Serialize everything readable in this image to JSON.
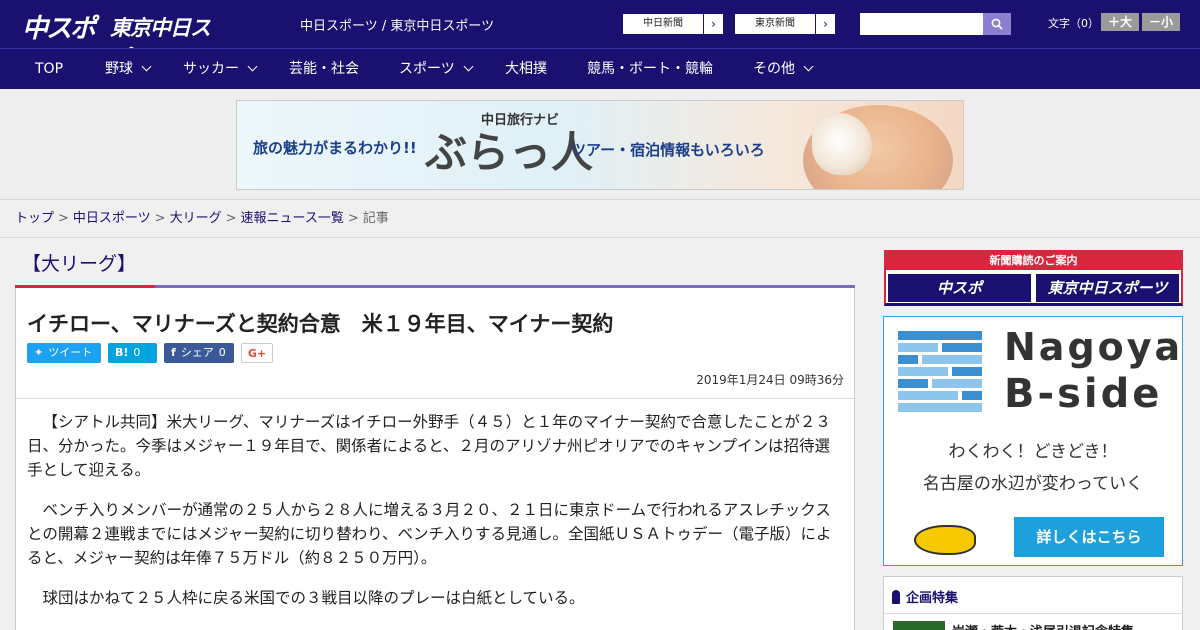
{
  "header": {
    "logo_primary": "中スポ",
    "logo_secondary": "東京中日スポーツ",
    "tagline": "中日スポーツ / 東京中日スポーツ",
    "paper_links": [
      "中日新聞",
      "東京新聞"
    ],
    "paper_chevron": "›",
    "search_placeholder": "",
    "font_size_label": "文字（0）",
    "font_plus": "＋大",
    "font_minus": "－小"
  },
  "nav": {
    "items": [
      "TOP",
      "野球",
      "サッカー",
      "芸能・社会",
      "スポーツ",
      "大相撲",
      "競馬・ボート・競輪",
      "その他"
    ]
  },
  "banner": {
    "lead": "旅の魅力がまるわかり!!",
    "brand_small": "中日旅行ナビ",
    "brand_big": "ぶらっ人",
    "tail": "ツアー・宿泊情報もいろいろ"
  },
  "breadcrumb": {
    "items": [
      "トップ",
      "中日スポーツ",
      "大リーグ",
      "速報ニュース一覧"
    ],
    "current": "記事",
    "separator": ">"
  },
  "article": {
    "category": "【大リーグ】",
    "title": "イチロー、マリナーズと契約合意　米１９年目、マイナー契約",
    "share": {
      "tweet": "ツイート",
      "hatena": "B!",
      "hatena_count": "0",
      "facebook": "シェア",
      "facebook_count": "0",
      "gplus": "G+"
    },
    "date": "2019年1月24日 09時36分",
    "paragraphs": [
      "【シアトル共同】米大リーグ、マリナーズはイチロー外野手（４５）と１年のマイナー契約で合意したことが２３日、分かった。今季はメジャー１９年目で、関係者によると、２月のアリゾナ州ピオリアでのキャンプインは招待選手として迎える。",
      "ベンチ入りメンバーが通常の２５人から２８人に増える３月２０、２１日に東京ドームで行われるアスレチックスとの開幕２連戦までにはメジャー契約に切り替わり、ベンチ入りする見通し。全国紙ＵＳＡトゥデー（電子版）によると、メジャー契約は年俸７５万ドル（約８２５０万円）。",
      "球団はかねて２５人枠に戻る米国での３戦目以降のプレーは白紙としている。"
    ]
  },
  "sidebar": {
    "subscribe_header": "新聞購読のご案内",
    "subscribe_buttons": [
      "中スポ",
      "東京中日スポーツ"
    ],
    "ad": {
      "name_line1": "Nagoya",
      "name_line2": "B-side",
      "tag1": "わくわく！どきどき！",
      "tag2": "名古屋の水辺が変わっていく",
      "cta": "詳しくはこちら"
    },
    "feature": {
      "title": "企画特集",
      "item": "岩瀬・荒木・浅尾引退記念特集"
    }
  },
  "colors": {
    "brand_navy": "#1a1070",
    "accent_red": "#d8263f",
    "twitter": "#1da1f2",
    "hatena": "#00a4de",
    "facebook": "#3b5998"
  }
}
